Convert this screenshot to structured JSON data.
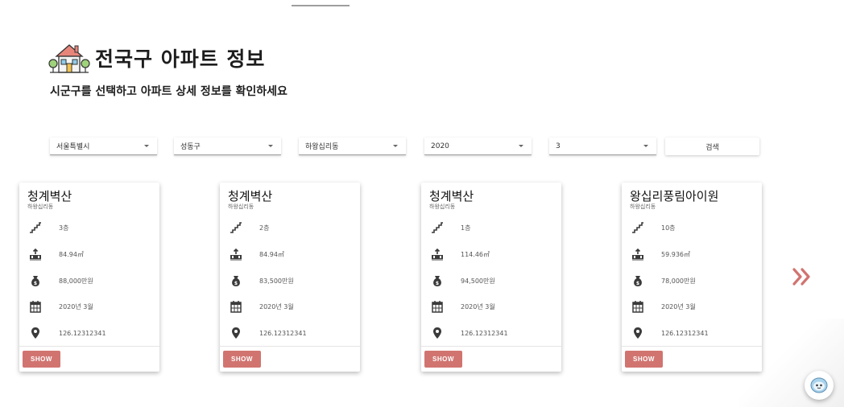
{
  "page": {
    "title": "전국구 아파트 정보",
    "subtitle": "시군구를 선택하고 아파트 상세 정보를 확인하세요",
    "icon": "house-icon"
  },
  "filters": {
    "sido": "서울특별시",
    "sigungu": "성동구",
    "dong": "하왕십리동",
    "year": "2020",
    "month": "3",
    "search_label": "검색"
  },
  "cards": [
    {
      "name": "청계벽산",
      "dong": "하왕십리동",
      "floor": "3층",
      "area": "84.94㎡",
      "price": "88,000만원",
      "date": "2020년 3월",
      "coord": "126.12312341",
      "show_label": "SHOW"
    },
    {
      "name": "청계벽산",
      "dong": "하왕십리동",
      "floor": "2층",
      "area": "84.94㎡",
      "price": "83,500만원",
      "date": "2020년 3월",
      "coord": "126.12312341",
      "show_label": "SHOW"
    },
    {
      "name": "청계벽산",
      "dong": "하왕십리동",
      "floor": "1층",
      "area": "114.46㎡",
      "price": "94,500만원",
      "date": "2020년 3월",
      "coord": "126.12312341",
      "show_label": "SHOW"
    },
    {
      "name": "왕십리풍림아이원",
      "dong": "하왕십리동",
      "floor": "10층",
      "area": "59.936㎡",
      "price": "78,000만원",
      "date": "2020년 3월",
      "coord": "126.12312341",
      "show_label": "SHOW"
    }
  ],
  "icons": {
    "floor": "stairs-icon",
    "area": "area-icon",
    "price": "money-bag-icon",
    "date": "calendar-icon",
    "coord": "location-pin-icon",
    "next": "double-chevron-right-icon",
    "chat": "chat-bot-icon"
  },
  "colors": {
    "accent": "#d17470",
    "icon_dark": "#3a3a3a"
  }
}
